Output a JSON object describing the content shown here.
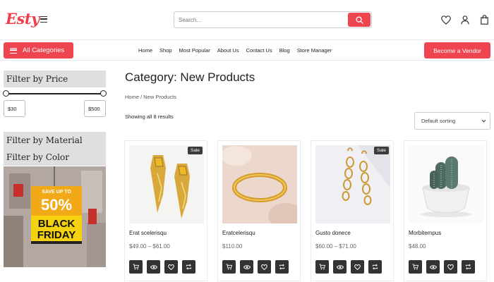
{
  "header": {
    "logo": "Esty",
    "search_placeholder": "Search..."
  },
  "nav": {
    "categories_label": "All Categories",
    "links": [
      "Home",
      "Shop",
      "Most Popular",
      "About Us",
      "Contact Us",
      "Blog",
      "Store Manager"
    ],
    "vendor_label": "Become a Vendor"
  },
  "sidebar": {
    "price_title": "Filter by Price",
    "min_price": "$30",
    "max_price": "$500",
    "material_title": "Filter by Material",
    "color_title": "Filter by Color",
    "promo_text": [
      "SAVE UP TO",
      "50%",
      "BLACK",
      "FRIDAY"
    ]
  },
  "main": {
    "title": "Category: New Products",
    "breadcrumb": "Home / New Products",
    "result_count": "Showing all 8 results",
    "sort_value": "Default sorting"
  },
  "products": [
    {
      "name": "Erat scelerisqu",
      "price": "$49.00 – $61.00",
      "badge": "Sale",
      "image": "gold-earrings"
    },
    {
      "name": "Eratcelerisqu",
      "price": "$110.00",
      "badge": "",
      "image": "gold-ring"
    },
    {
      "name": "Gusto donece",
      "price": "$60.00 – $71.00",
      "badge": "Sale",
      "image": "drop-earrings"
    },
    {
      "name": "Morbitempus",
      "price": "$48.00",
      "badge": "",
      "image": "cactus-pot"
    }
  ],
  "colors": {
    "accent": "#ef4550",
    "dark_button": "#333333",
    "widget_bg": "#e1dede"
  }
}
